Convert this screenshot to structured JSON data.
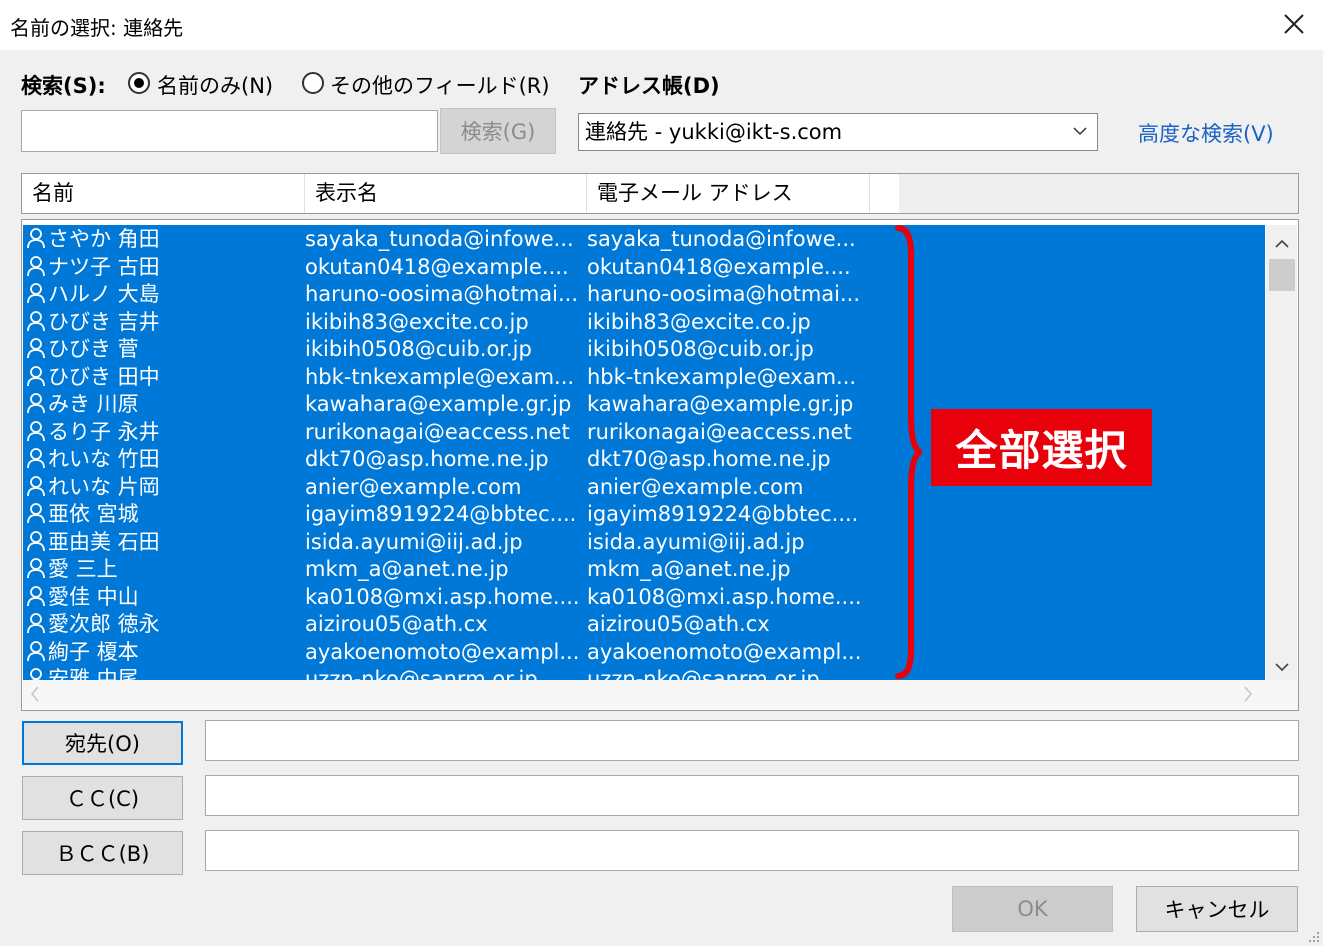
{
  "window": {
    "title": "名前の選択: 連絡先"
  },
  "search": {
    "label": "検索(S):",
    "option_names": "名前のみ(N)",
    "option_other": "その他のフィールド(R)",
    "selected_option": "名前のみ(N)",
    "input_value": "",
    "button": "検索(G)"
  },
  "address_book": {
    "label": "アドレス帳(D)",
    "value": "連絡先 - yukki@ikt-s.com"
  },
  "advanced_search": "高度な検索(V)",
  "columns": [
    "名前",
    "表示名",
    "電子メール アドレス"
  ],
  "rows": [
    {
      "name": "さやか 角田",
      "display": "sayaka_tunoda@infowe...",
      "email": "sayaka_tunoda@infowe..."
    },
    {
      "name": "ナツ子 古田",
      "display": "okutan0418@example....",
      "email": "okutan0418@example...."
    },
    {
      "name": "ハルノ 大島",
      "display": "haruno-oosima@hotmai...",
      "email": "haruno-oosima@hotmai..."
    },
    {
      "name": "ひびき 吉井",
      "display": "ikibih83@excite.co.jp",
      "email": "ikibih83@excite.co.jp"
    },
    {
      "name": "ひびき 菅",
      "display": "ikibih0508@cuib.or.jp",
      "email": "ikibih0508@cuib.or.jp"
    },
    {
      "name": "ひびき 田中",
      "display": "hbk-tnkexample@exam...",
      "email": "hbk-tnkexample@exam..."
    },
    {
      "name": "みき 川原",
      "display": "kawahara@example.gr.jp",
      "email": "kawahara@example.gr.jp"
    },
    {
      "name": "るり子 永井",
      "display": "rurikonagai@eaccess.net",
      "email": "rurikonagai@eaccess.net"
    },
    {
      "name": "れいな 竹田",
      "display": "dkt70@asp.home.ne.jp",
      "email": "dkt70@asp.home.ne.jp"
    },
    {
      "name": "れいな 片岡",
      "display": "anier@example.com",
      "email": "anier@example.com"
    },
    {
      "name": "亜依 宮城",
      "display": "igayim8919224@bbtec....",
      "email": "igayim8919224@bbtec...."
    },
    {
      "name": "亜由美 石田",
      "display": "isida.ayumi@iij.ad.jp",
      "email": "isida.ayumi@iij.ad.jp"
    },
    {
      "name": "愛 三上",
      "display": "mkm_a@anet.ne.jp",
      "email": "mkm_a@anet.ne.jp"
    },
    {
      "name": "愛佳 中山",
      "display": "ka0108@mxi.asp.home....",
      "email": "ka0108@mxi.asp.home...."
    },
    {
      "name": "愛次郎 徳永",
      "display": "aizirou05@ath.cx",
      "email": "aizirou05@ath.cx"
    },
    {
      "name": "絢子 榎本",
      "display": "ayakoenomoto@exampl...",
      "email": "ayakoenomoto@exampl..."
    },
    {
      "name": "安雅 中尾",
      "display": "uzzn-nko@sanrm.or.jp",
      "email": "uzzn-nko@sanrm.or.jp"
    }
  ],
  "recipients": {
    "to_label": "宛先(O)",
    "cc_label": "ＣＣ(C)",
    "bcc_label": "ＢＣＣ(B)",
    "to_value": "",
    "cc_value": "",
    "bcc_value": ""
  },
  "footer": {
    "ok": "OK",
    "cancel": "キャンセル"
  },
  "annotation": {
    "text": "全部選択",
    "color": "#e8000b"
  },
  "colors": {
    "selection": "#0078d7",
    "link": "#1a62c6"
  }
}
